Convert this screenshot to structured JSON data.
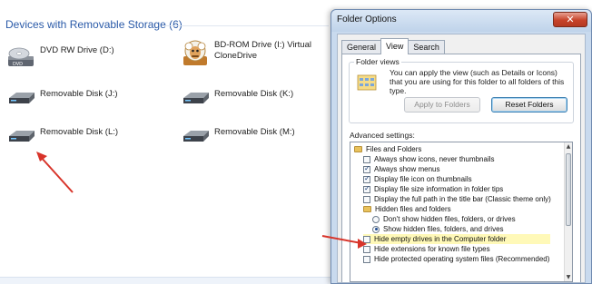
{
  "explorer": {
    "group_title": "Devices with Removable Storage (6)",
    "devices": [
      {
        "icon": "dvd-drive-icon",
        "label": "DVD RW Drive (D:)"
      },
      {
        "icon": "clonedrive-sheep-icon",
        "label": "BD-ROM Drive (I:) Virtual CloneDrive"
      },
      {
        "icon": "removable-disk-icon",
        "label": "Removable Disk (J:)"
      },
      {
        "icon": "removable-disk-icon",
        "label": "Removable Disk (K:)"
      },
      {
        "icon": "removable-disk-icon",
        "label": "Removable Disk (L:)"
      },
      {
        "icon": "removable-disk-icon",
        "label": "Removable Disk (M:)"
      }
    ]
  },
  "dialog": {
    "title": "Folder Options",
    "close_label": "✕",
    "tabs": [
      {
        "label": "General",
        "active": false
      },
      {
        "label": "View",
        "active": true
      },
      {
        "label": "Search",
        "active": false
      }
    ],
    "folder_views": {
      "group_label": "Folder views",
      "description": "You can apply the view (such as Details or Icons) that you are using for this folder to all folders of this type.",
      "apply_button": "Apply to Folders",
      "reset_button": "Reset Folders"
    },
    "advanced_label": "Advanced settings:",
    "settings": [
      {
        "kind": "folder",
        "label": "Files and Folders",
        "checked": false
      },
      {
        "kind": "checkbox",
        "label": "Always show icons, never thumbnails",
        "checked": false
      },
      {
        "kind": "checkbox",
        "label": "Always show menus",
        "checked": true
      },
      {
        "kind": "checkbox",
        "label": "Display file icon on thumbnails",
        "checked": true
      },
      {
        "kind": "checkbox",
        "label": "Display file size information in folder tips",
        "checked": true
      },
      {
        "kind": "checkbox",
        "label": "Display the full path in the title bar (Classic theme only)",
        "checked": false
      },
      {
        "kind": "folder",
        "label": "Hidden files and folders",
        "checked": false
      },
      {
        "kind": "radio",
        "label": "Don't show hidden files, folders, or drives",
        "checked": false
      },
      {
        "kind": "radio",
        "label": "Show hidden files, folders, and drives",
        "checked": true
      },
      {
        "kind": "checkbox",
        "label": "Hide empty drives in the Computer folder",
        "checked": false,
        "highlight": true
      },
      {
        "kind": "checkbox",
        "label": "Hide extensions for known file types",
        "checked": false
      },
      {
        "kind": "checkbox",
        "label": "Hide protected operating system files (Recommended)",
        "checked": false
      }
    ]
  },
  "colors": {
    "annotation_arrow": "#d8342a",
    "highlight_row": "#fff9b8",
    "group_title": "#2a5aa8"
  }
}
